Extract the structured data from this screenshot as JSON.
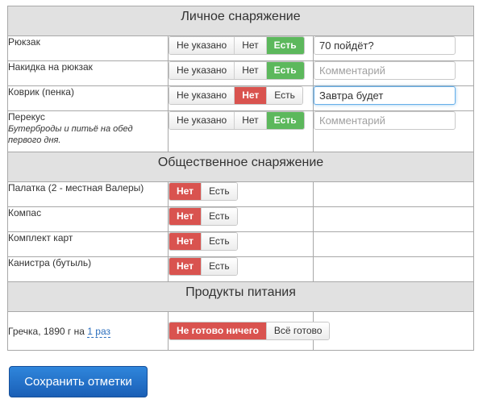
{
  "sections": {
    "personal": "Личное снаряжение",
    "shared": "Общественное снаряжение",
    "food": "Продукты питания"
  },
  "personal_items": [
    {
      "name": "Рюкзак",
      "note": "",
      "options": [
        "Не указано",
        "Нет",
        "Есть"
      ],
      "selected": "Есть",
      "comment_value": "70 пойдёт?",
      "comment_placeholder": "Комментарий"
    },
    {
      "name": "Накидка на рюкзак",
      "note": "",
      "options": [
        "Не указано",
        "Нет",
        "Есть"
      ],
      "selected": "Есть",
      "comment_value": "",
      "comment_placeholder": "Комментарий"
    },
    {
      "name": "Коврик (пенка)",
      "note": "",
      "options": [
        "Не указано",
        "Нет",
        "Есть"
      ],
      "selected": "Нет",
      "comment_value": "Завтра будет",
      "comment_placeholder": "Комментарий"
    },
    {
      "name": "Перекус",
      "note": "Бутерброды и питьё на обед первого дня.",
      "options": [
        "Не указано",
        "Нет",
        "Есть"
      ],
      "selected": "Есть",
      "comment_value": "",
      "comment_placeholder": "Комментарий"
    }
  ],
  "shared_items": [
    {
      "name": "Палатка (2 - местная Валеры)",
      "options": [
        "Нет",
        "Есть"
      ],
      "selected": "Нет"
    },
    {
      "name": "Компас",
      "options": [
        "Нет",
        "Есть"
      ],
      "selected": "Нет"
    },
    {
      "name": "Комплект карт",
      "options": [
        "Нет",
        "Есть"
      ],
      "selected": "Нет"
    },
    {
      "name": "Канистра (бутыль)",
      "options": [
        "Нет",
        "Есть"
      ],
      "selected": "Нет"
    }
  ],
  "food_items": [
    {
      "name_prefix": "Гречка, 1890 г на",
      "link": "1 раз",
      "options": [
        "Не готово ничего",
        "Всё готово"
      ],
      "selected": "Не готово ничего"
    }
  ],
  "save_label": "Сохранить отметки",
  "colors": {
    "selected_yes": "#5cb85c",
    "selected_no": "#d9534f",
    "header_bg": "#e1e1e1",
    "save_button": "#1a5fb6"
  }
}
